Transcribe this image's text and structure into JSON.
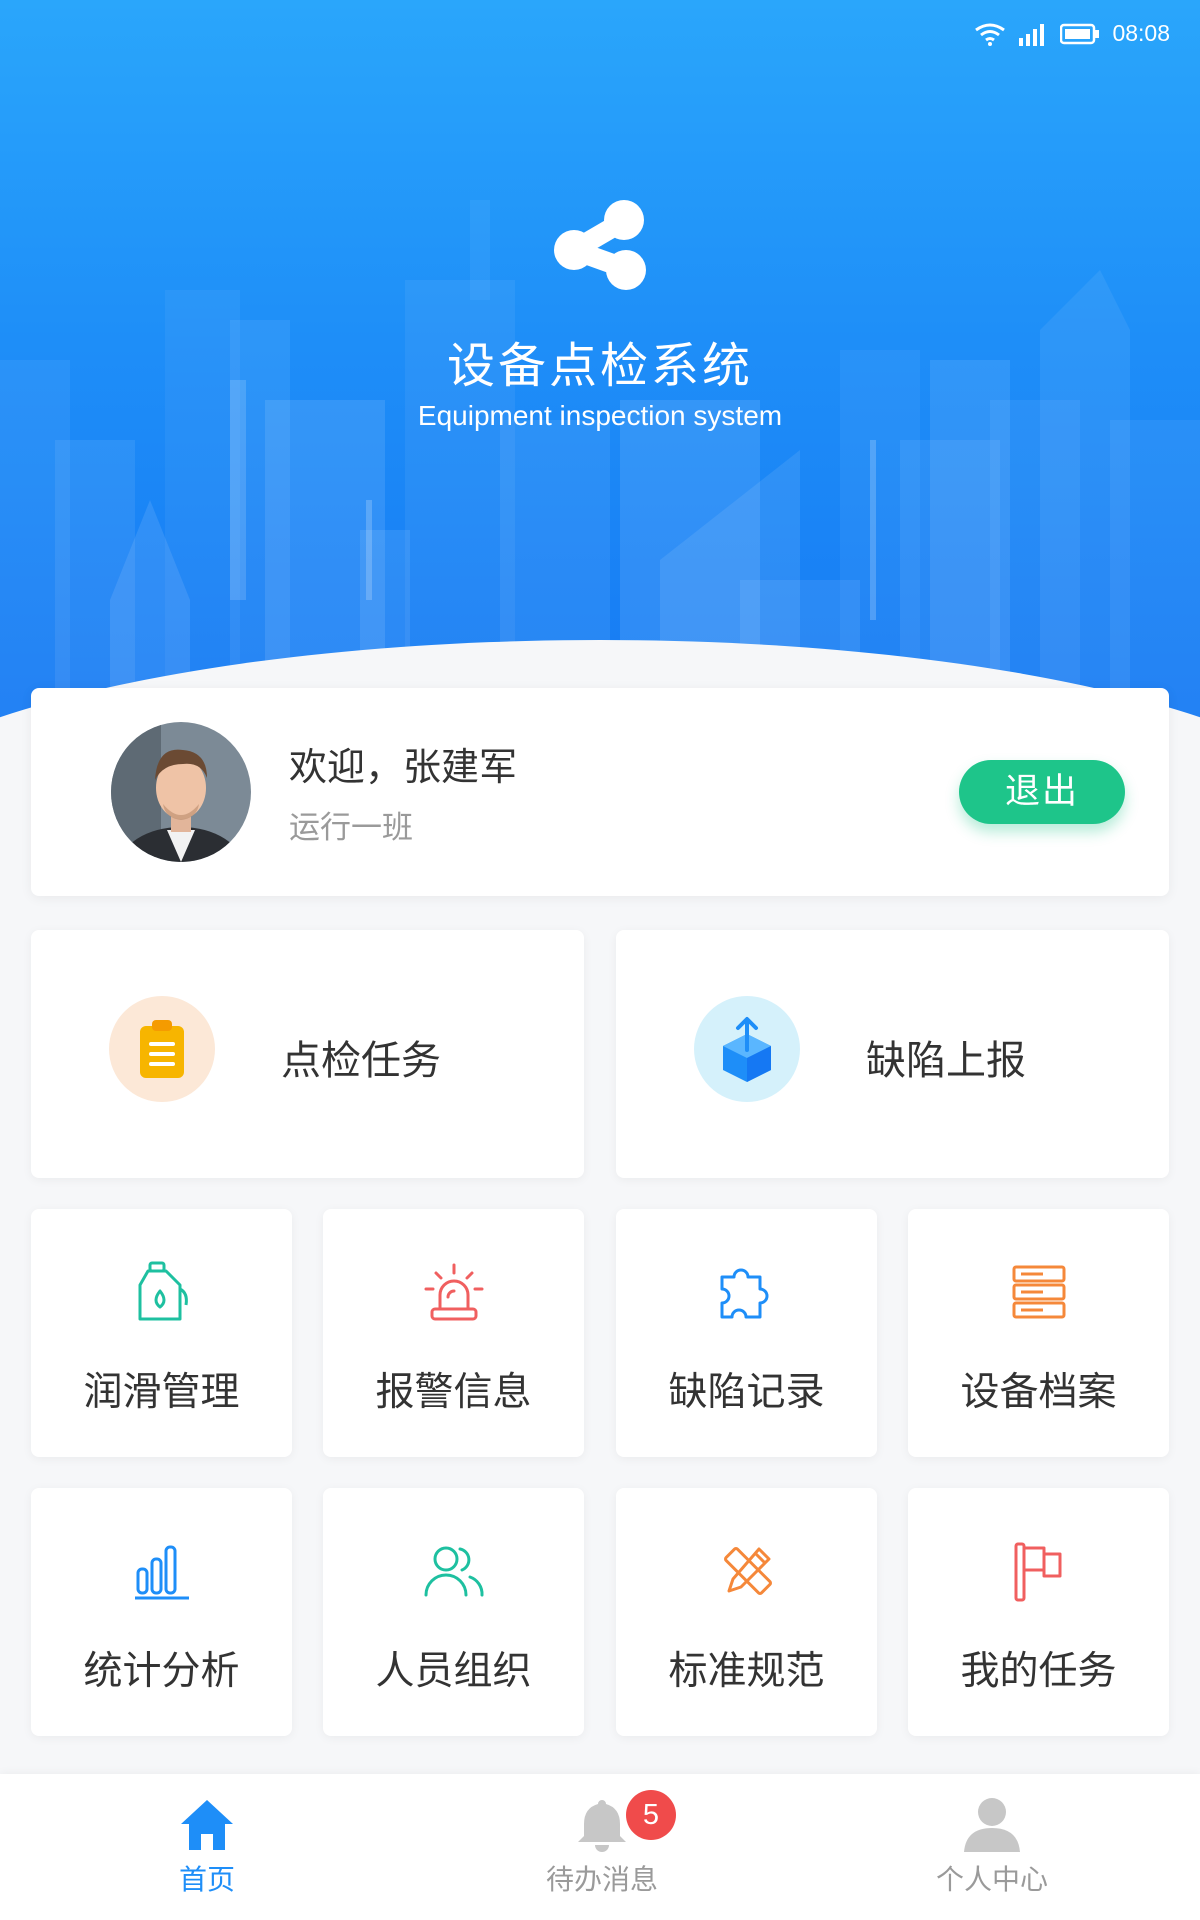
{
  "status_bar": {
    "time": "08:08"
  },
  "app": {
    "title": "设备点检系统",
    "subtitle": "Equipment inspection system"
  },
  "user": {
    "welcome": "欢迎，张建军",
    "team": "运行一班",
    "logout_label": "退出"
  },
  "main_tiles": [
    {
      "label": "点检任务",
      "icon": "clipboard-icon",
      "color": "#f7b500"
    },
    {
      "label": "缺陷上报",
      "icon": "upload-box-icon",
      "color": "#1e8ef8"
    }
  ],
  "grid_tiles": [
    {
      "label": "润滑管理",
      "icon": "oil-bottle-icon",
      "color": "#1ec0a0"
    },
    {
      "label": "报警信息",
      "icon": "alarm-siren-icon",
      "color": "#f05f5f"
    },
    {
      "label": "缺陷记录",
      "icon": "puzzle-icon",
      "color": "#1e8ef8"
    },
    {
      "label": "设备档案",
      "icon": "server-rack-icon",
      "color": "#f5883a"
    },
    {
      "label": "统计分析",
      "icon": "bar-chart-icon",
      "color": "#1e8ef8"
    },
    {
      "label": "人员组织",
      "icon": "people-icon",
      "color": "#1ec0a0"
    },
    {
      "label": "标准规范",
      "icon": "ruler-pencil-icon",
      "color": "#f5883a"
    },
    {
      "label": "我的任务",
      "icon": "flag-icon",
      "color": "#f05f5f"
    }
  ],
  "tabbar": {
    "items": [
      {
        "label": "首页",
        "icon": "home-icon",
        "active": true
      },
      {
        "label": "待办消息",
        "icon": "bell-icon",
        "active": false
      },
      {
        "label": "个人中心",
        "icon": "user-icon",
        "active": false
      }
    ],
    "badge_count": "5"
  },
  "colors": {
    "primary": "#1e8ef8",
    "logout": "#1ec58a",
    "badge": "#f04b4b"
  }
}
